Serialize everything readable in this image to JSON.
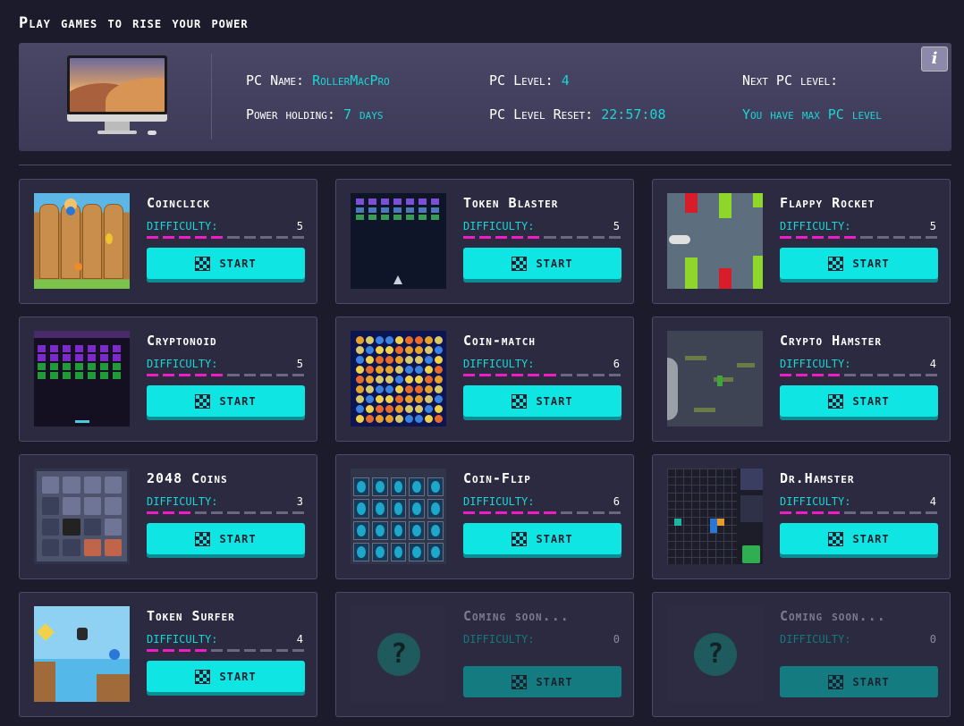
{
  "page": {
    "title": "Play games to rise your power"
  },
  "pc": {
    "name_label": "PC Name:",
    "name_value": "RollerMacPro",
    "level_label": "PC Level:",
    "level_value": "4",
    "next_label": "Next PC level:",
    "next_value": "You have max PC level",
    "holding_label": "Power holding:",
    "holding_value": "7 days",
    "reset_label": "PC Level Reset:",
    "reset_value": "22:57:08",
    "info_icon": "i"
  },
  "games": [
    {
      "title": "Coinclick",
      "difficulty_label": "DIFFICULTY:",
      "difficulty": 5,
      "start_label": "START",
      "thumb": "fence-coin-game"
    },
    {
      "title": "Token Blaster",
      "difficulty_label": "DIFFICULTY:",
      "difficulty": 5,
      "start_label": "START",
      "thumb": "space-invaders-game"
    },
    {
      "title": "Flappy Rocket",
      "difficulty_label": "DIFFICULTY:",
      "difficulty": 5,
      "start_label": "START",
      "thumb": "flappy-pipes-game"
    },
    {
      "title": "Cryptonoid",
      "difficulty_label": "DIFFICULTY:",
      "difficulty": 5,
      "start_label": "START",
      "thumb": "brick-breaker-game"
    },
    {
      "title": "Coin-match",
      "difficulty_label": "DIFFICULTY:",
      "difficulty": 6,
      "start_label": "START",
      "thumb": "match-three-game"
    },
    {
      "title": "Crypto Hamster",
      "difficulty_label": "DIFFICULTY:",
      "difficulty": 4,
      "start_label": "START",
      "thumb": "platform-jump-game"
    },
    {
      "title": "2048 Coins",
      "difficulty_label": "DIFFICULTY:",
      "difficulty": 3,
      "start_label": "START",
      "thumb": "2048-grid-game"
    },
    {
      "title": "Coin-Flip",
      "difficulty_label": "DIFFICULTY:",
      "difficulty": 6,
      "start_label": "START",
      "thumb": "card-flip-game"
    },
    {
      "title": "Dr.Hamster",
      "difficulty_label": "DIFFICULTY:",
      "difficulty": 4,
      "start_label": "START",
      "thumb": "falling-blocks-game"
    },
    {
      "title": "Token Surfer",
      "difficulty_label": "DIFFICULTY:",
      "difficulty": 4,
      "start_label": "START",
      "thumb": "runner-game"
    },
    {
      "title": "Coming soon...",
      "difficulty_label": "DIFFICULTY:",
      "difficulty": 0,
      "start_label": "START",
      "thumb": "question-icon",
      "disabled": true
    },
    {
      "title": "Coming soon...",
      "difficulty_label": "DIFFICULTY:",
      "difficulty": 0,
      "start_label": "START",
      "thumb": "question-icon",
      "disabled": true
    }
  ],
  "difficulty_max": 10,
  "colors": {
    "accent": "#0fe6e3",
    "difficulty_fill": "#ec1ec4",
    "label": "#19d7d4",
    "background": "#1c1b2b"
  }
}
